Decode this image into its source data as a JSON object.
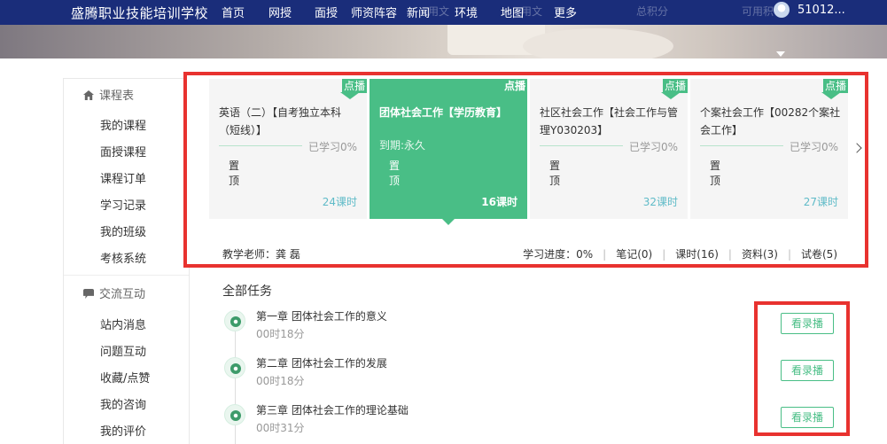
{
  "header": {
    "school_name": "盛腾职业技能培训学校",
    "nav": [
      "首页",
      "网授",
      "面授",
      "师资阵容",
      "新闻",
      "环境",
      "地图",
      "更多"
    ],
    "overlay_text": [
      "用文",
      "总积分",
      "可用积"
    ],
    "user_id": "51012..."
  },
  "sidebar": {
    "section1_title": "课程表",
    "section1_items": [
      "我的课程",
      "面授课程",
      "课程订单",
      "学习记录",
      "我的班级",
      "考核系统"
    ],
    "section2_title": "交流互动",
    "section2_items": [
      "站内消息",
      "问题互动",
      "收藏/点赞",
      "我的咨询",
      "我的评价"
    ]
  },
  "courses": [
    {
      "title": "英语（二）【自考独立本科（短线）】",
      "tag": "点播",
      "progress": "已学习0%",
      "pin": "置顶",
      "hours": "24课时"
    },
    {
      "title": "团体社会工作【学历教育】",
      "tag": "点播",
      "expire": "到期:永久",
      "pin": "置顶",
      "hours": "16课时"
    },
    {
      "title": "社区社会工作【社会工作与管理Y030203】",
      "tag": "点播",
      "progress": "已学习0%",
      "pin": "置顶",
      "hours": "32课时"
    },
    {
      "title": "个案社会工作【00282个案社会工作】",
      "tag": "点播",
      "progress": "已学习0%",
      "pin": "置顶",
      "hours": "27课时"
    }
  ],
  "course_footer": {
    "teacher": "教学老师：龚 磊",
    "progress": "学习进度：0%",
    "notes": "笔记(0)",
    "lessons": "课时(16)",
    "materials": "资料(3)",
    "papers": "试卷(5)"
  },
  "tasks": {
    "title": "全部任务",
    "button_label": "看录播",
    "items": [
      {
        "title": "第一章 团体社会工作的意义",
        "duration": "00时18分"
      },
      {
        "title": "第二章 团体社会工作的发展",
        "duration": "00时18分"
      },
      {
        "title": "第三章 团体社会工作的理论基础",
        "duration": "00时31分"
      }
    ]
  },
  "colors": {
    "nav_bg": "#1a2d7a",
    "accent_green": "#49be86",
    "highlight_red": "#e8322f"
  }
}
